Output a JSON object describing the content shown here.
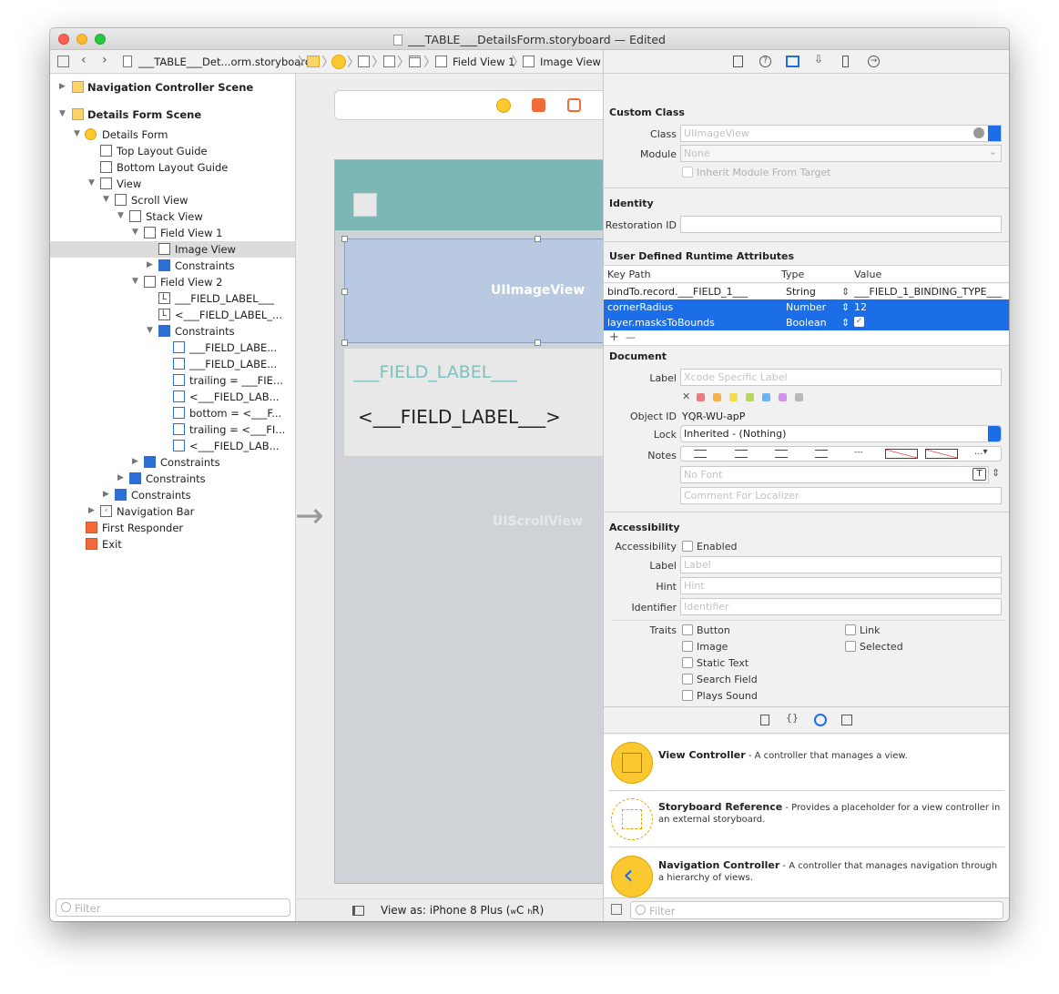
{
  "window": {
    "title": "___TABLE___DetailsForm.storyboard — Edited"
  },
  "breadcrumb": {
    "file": "___TABLE___Det...orm.storyboard",
    "field_view": "Field View 1",
    "image_view": "Image View"
  },
  "outline": {
    "items": [
      {
        "label": "Navigation Controller Scene"
      },
      {
        "label": "Details Form Scene"
      },
      {
        "label": "Details Form"
      },
      {
        "label": "Top Layout Guide"
      },
      {
        "label": "Bottom Layout Guide"
      },
      {
        "label": "View"
      },
      {
        "label": "Scroll View"
      },
      {
        "label": "Stack View"
      },
      {
        "label": "Field View 1"
      },
      {
        "label": "Image View"
      },
      {
        "label": "Constraints"
      },
      {
        "label": "Field View 2"
      },
      {
        "label": "___FIELD_LABEL___"
      },
      {
        "label": "<___FIELD_LABEL_..."
      },
      {
        "label": "Constraints"
      },
      {
        "label": "___FIELD_LABE..."
      },
      {
        "label": "___FIELD_LABE..."
      },
      {
        "label": "trailing = ___FIE..."
      },
      {
        "label": "<___FIELD_LAB..."
      },
      {
        "label": "bottom = <___F..."
      },
      {
        "label": "trailing = <___FI..."
      },
      {
        "label": "<___FIELD_LAB..."
      },
      {
        "label": "Constraints"
      },
      {
        "label": "Constraints"
      },
      {
        "label": "Constraints"
      },
      {
        "label": "Navigation Bar"
      },
      {
        "label": "First Responder"
      },
      {
        "label": "Exit"
      }
    ],
    "filter_placeholder": "Filter"
  },
  "canvas": {
    "image_view_label": "UIImageView",
    "field_label": "___FIELD_LABEL___",
    "field_label_value": "<___FIELD_LABEL___>",
    "scroll_view_label": "UIScrollView",
    "view_as": "View as: iPhone 8 Plus (",
    "view_as_w": "w",
    "view_as_c": "C",
    "view_as_h": "h",
    "view_as_r": "R",
    "view_as_close": ")"
  },
  "inspector": {
    "custom_class": {
      "header": "Custom Class",
      "class_label": "Class",
      "class_placeholder": "UIImageView",
      "module_label": "Module",
      "module_placeholder": "None",
      "inherit_label": "Inherit Module From Target"
    },
    "identity": {
      "header": "Identity",
      "restoration_label": "Restoration ID"
    },
    "runtime_attrs": {
      "header": "User Defined Runtime Attributes",
      "col_keypath": "Key Path",
      "col_type": "Type",
      "col_value": "Value",
      "rows": [
        {
          "key": "bindTo.record.___FIELD_1___",
          "type": "String",
          "value": "___FIELD_1_BINDING_TYPE___"
        },
        {
          "key": "cornerRadius",
          "type": "Number",
          "value": "12"
        },
        {
          "key": "layer.masksToBounds",
          "type": "Boolean",
          "value": "✓"
        }
      ],
      "add": "+",
      "remove": "—"
    },
    "document": {
      "header": "Document",
      "label_label": "Label",
      "label_placeholder": "Xcode Specific Label",
      "object_id_label": "Object ID",
      "object_id": "YQR-WU-apP",
      "lock_label": "Lock",
      "lock_value": "Inherited - (Nothing)",
      "notes_label": "Notes",
      "font_placeholder": "No Font",
      "comment_placeholder": "Comment For Localizer",
      "label_colors": [
        "#f07b7b",
        "#f5b14c",
        "#f2dc4d",
        "#b4d95a",
        "#6cb3f2",
        "#d394e8",
        "#b9b9b9"
      ]
    },
    "accessibility": {
      "header": "Accessibility",
      "accessibility_label": "Accessibility",
      "enabled_label": "Enabled",
      "label_label": "Label",
      "label_placeholder": "Label",
      "hint_label": "Hint",
      "hint_placeholder": "Hint",
      "identifier_label": "Identifier",
      "identifier_placeholder": "Identifier",
      "traits_label": "Traits",
      "traits_left": [
        "Button",
        "Image",
        "Static Text",
        "Search Field",
        "Plays Sound"
      ],
      "traits_right": [
        "Link",
        "Selected"
      ]
    },
    "library": {
      "items": [
        {
          "title": "View Controller",
          "desc": " - A controller that manages a view."
        },
        {
          "title": "Storyboard Reference",
          "desc": " - Provides a placeholder for a view controller in an external storyboard."
        },
        {
          "title": "Navigation Controller",
          "desc": " - A controller that manages navigation through a hierarchy of views."
        }
      ],
      "filter_placeholder": "Filter"
    }
  },
  "colors": {
    "accent_blue": "#1b6ee8",
    "nav_teal": "#7bb7b4",
    "image_view_fill": "#b8c9e1",
    "field_label_teal": "#7bc2bf",
    "library_yellow": "#fbc830"
  }
}
